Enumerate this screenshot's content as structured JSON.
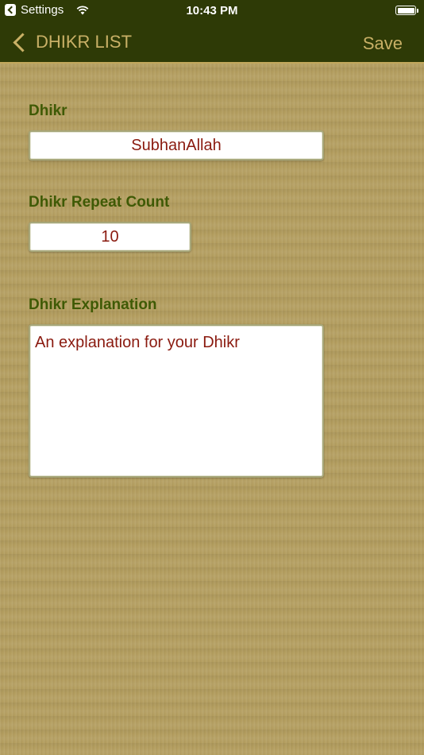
{
  "status_bar": {
    "back_app": "Settings",
    "time": "10:43 PM"
  },
  "nav": {
    "back_label": "DHIKR LIST",
    "save_label": "Save"
  },
  "form": {
    "dhikr_label": "Dhikr",
    "dhikr_value": "SubhanAllah",
    "count_label": "Dhikr Repeat Count",
    "count_value": "10",
    "explanation_label": "Dhikr Explanation",
    "explanation_placeholder": "An explanation for your Dhikr"
  },
  "colors": {
    "nav_background": "#2e3a06",
    "nav_accent": "#c9b066",
    "label_green": "#3f5a05",
    "value_red": "#8a1a0f",
    "background_tan": "#b39d5e"
  },
  "icons": {
    "status_back": "back-app-icon",
    "wifi": "wifi-icon",
    "battery": "battery-icon",
    "nav_back": "chevron-left-icon"
  }
}
